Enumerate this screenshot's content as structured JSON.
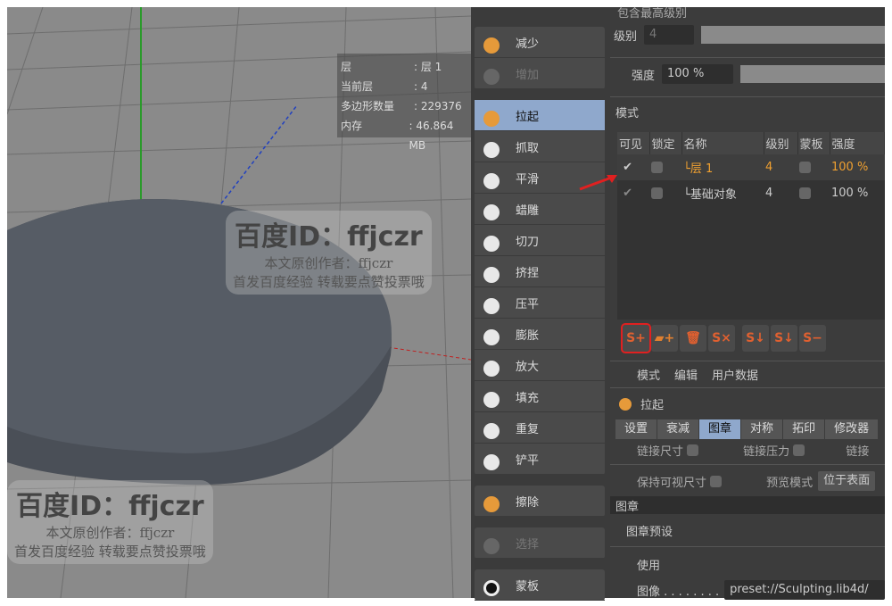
{
  "viewport": {
    "hud": [
      {
        "k": "层",
        "v": ": 层 1"
      },
      {
        "k": "当前层",
        "v": ": 4"
      },
      {
        "k": "多边形数量",
        "v": ": 229376"
      },
      {
        "k": "内存",
        "v": ": 46.864 MB"
      }
    ]
  },
  "watermark": {
    "id": "百度ID：ffjczr",
    "author": "本文原创作者：ffjczr",
    "note": "首发百度经验 转载要点赞投票哦"
  },
  "tools": {
    "top": [
      {
        "label": "减少"
      },
      {
        "label": "增加"
      }
    ],
    "main": [
      {
        "label": "拉起",
        "selected": true
      },
      {
        "label": "抓取"
      },
      {
        "label": "平滑"
      },
      {
        "label": "蜡雕"
      },
      {
        "label": "切刀"
      },
      {
        "label": "挤捏"
      },
      {
        "label": "压平"
      },
      {
        "label": "膨胀"
      },
      {
        "label": "放大"
      },
      {
        "label": "填充"
      },
      {
        "label": "重复"
      },
      {
        "label": "铲平"
      }
    ],
    "erase": "擦除",
    "select": "选择",
    "mask": "蒙板"
  },
  "panel": {
    "include_top": "包含最高级别",
    "level_label": "级别",
    "level_value": "4",
    "strength_label": "强度",
    "strength_value": "100 %",
    "mode_label": "模式",
    "columns": [
      "可见",
      "锁定",
      "名称",
      "级别",
      "蒙板",
      "强度"
    ],
    "layers": [
      {
        "name": "层 1",
        "level": "4",
        "strength": "100 %",
        "visible": true,
        "active": true
      },
      {
        "name": "基础对象",
        "level": "4",
        "strength": "100 %",
        "visible": true,
        "active": false
      }
    ],
    "menu": [
      "模式",
      "编辑",
      "用户数据"
    ],
    "brush_name": "拉起",
    "tabs": [
      {
        "label": "设置"
      },
      {
        "label": "衰减"
      },
      {
        "label": "图章",
        "active": true
      },
      {
        "label": "对称"
      },
      {
        "label": "拓印"
      },
      {
        "label": "修改器"
      }
    ],
    "link_size": "链接尺寸",
    "link_pressure": "链接压力",
    "link_more": "链接",
    "keep_visible": "保持可视尺寸",
    "preview_mode_label": "预览模式",
    "preview_mode_value": "位于表面",
    "stamp_section": "图章",
    "stamp_preset": "图章预设",
    "use_label": "使用",
    "image_label": "图像 . . . . . . . .",
    "image_value": "preset://Sculpting.lib4d/"
  },
  "colors": {
    "selected": "#8fa8cc",
    "accent": "#f0a030",
    "highlight_box": "#e02020"
  }
}
